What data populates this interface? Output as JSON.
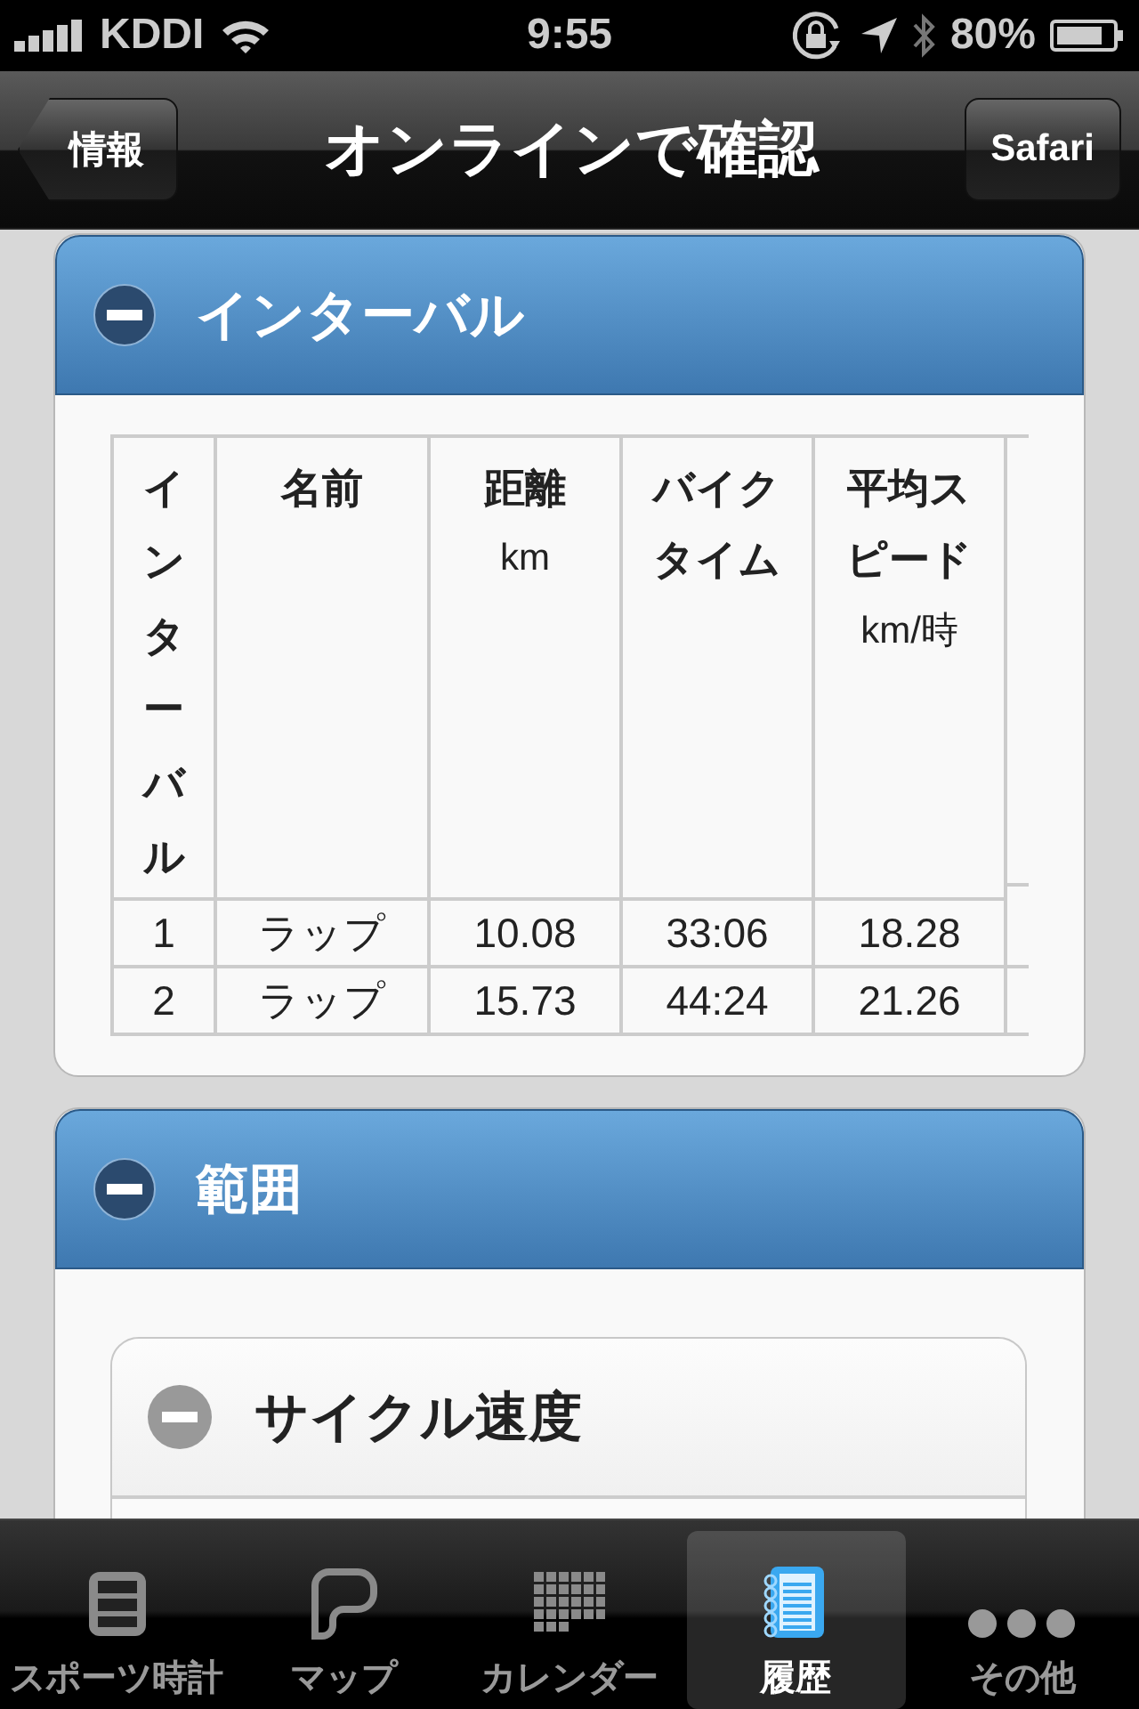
{
  "status_bar": {
    "carrier": "KDDI",
    "time": "9:55",
    "battery": "80%"
  },
  "nav_bar": {
    "back_button": "情報",
    "title": "オンラインで確認",
    "right_button": "Safari"
  },
  "sections": [
    {
      "title": "インターバル",
      "expanded": true,
      "table": {
        "columns": [
          {
            "title": "インターバル",
            "kind": "vertical"
          },
          {
            "title": "名前"
          },
          {
            "title": "距離",
            "unit": "km"
          },
          {
            "title": "バイクタイム"
          },
          {
            "title": "平均スピード",
            "unit": "km/時"
          }
        ],
        "rows": [
          [
            "1",
            "ラップ",
            "10.08",
            "33:06",
            "18.28"
          ],
          [
            "2",
            "ラップ",
            "15.73",
            "44:24",
            "21.26"
          ]
        ]
      }
    },
    {
      "title": "範囲",
      "expanded": true,
      "subsections": [
        {
          "title": "サイクル速度",
          "expanded": true
        }
      ]
    }
  ],
  "tab_bar": [
    {
      "label": "スポーツ時計",
      "selected": false
    },
    {
      "label": "マップ",
      "selected": false
    },
    {
      "label": "カレンダー",
      "selected": false
    },
    {
      "label": "履歴",
      "selected": true
    },
    {
      "label": "その他",
      "selected": false
    }
  ]
}
